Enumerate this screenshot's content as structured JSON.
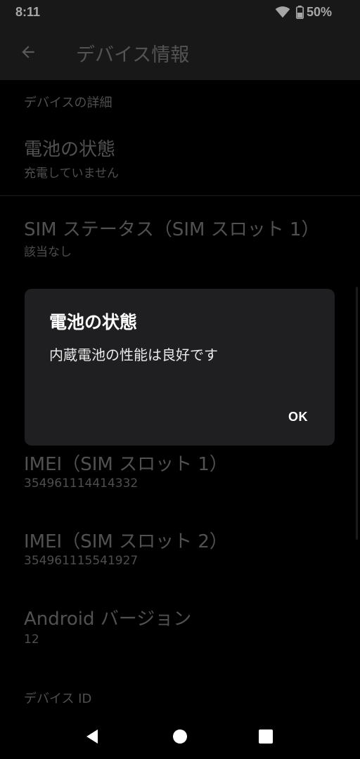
{
  "status_bar": {
    "time": "8:11",
    "battery_text": "50%"
  },
  "app_bar": {
    "title": "デバイス情報"
  },
  "list": {
    "section_details": "デバイスの詳細",
    "items": [
      {
        "title": "電池の状態",
        "summary": "充電していません"
      },
      {
        "title": "SIM ステータス（SIM スロット 1）",
        "summary": "該当なし"
      },
      {
        "title": "IMEI（SIM スロット 1）",
        "summary": "354961114414332"
      },
      {
        "title": "IMEI（SIM スロット 2）",
        "summary": "354961115541927"
      },
      {
        "title": "Android バージョン",
        "summary": "12"
      }
    ],
    "section_device_id": "デバイス ID"
  },
  "dialog": {
    "title": "電池の状態",
    "message": "内蔵電池の性能は良好です",
    "ok_label": "OK"
  },
  "icons": {
    "back": "arrow-back-icon",
    "wifi": "wifi-icon",
    "battery": "battery-icon",
    "nav_back": "triangle-back-icon",
    "nav_home": "circle-home-icon",
    "nav_recents": "square-recents-icon"
  },
  "colors": {
    "background": "#000000",
    "app_bar": "#262626",
    "dialog": "#1f1f21"
  }
}
